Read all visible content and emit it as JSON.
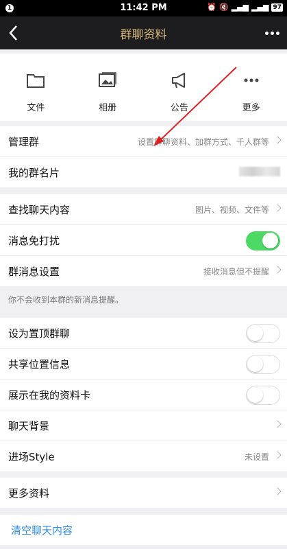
{
  "status": {
    "time": "11:42 PM",
    "notification_badge": "1",
    "battery": "97"
  },
  "nav": {
    "title": "群聊资料"
  },
  "quick_actions": [
    {
      "label": "文件",
      "icon": "folder-icon"
    },
    {
      "label": "相册",
      "icon": "image-icon"
    },
    {
      "label": "公告",
      "icon": "megaphone-icon"
    },
    {
      "label": "更多",
      "icon": "more-dots-icon"
    }
  ],
  "group1": [
    {
      "label": "管理群",
      "value": "设置群聊资料、加群方式、千人群等"
    },
    {
      "label": "我的群名片",
      "value": ""
    }
  ],
  "group2": [
    {
      "label": "查找聊天内容",
      "value": "图片、视频、文件等"
    },
    {
      "label": "消息免打扰",
      "toggle": true
    },
    {
      "label": "群消息设置",
      "value": "接收消息但不提醒"
    }
  ],
  "hint": "你不会收到本群的新消息提醒。",
  "group3": [
    {
      "label": "设为置顶群聊",
      "toggle": false
    },
    {
      "label": "共享位置信息",
      "toggle": false
    },
    {
      "label": "展示在我的资料卡",
      "toggle": false
    },
    {
      "label": "聊天背景",
      "value": ""
    },
    {
      "label": "进场Style",
      "value": "未设置"
    }
  ],
  "group4": [
    {
      "label": "更多资料",
      "value": ""
    }
  ],
  "clear": {
    "label": "清空聊天内容"
  },
  "colors": {
    "nav_bg": "#1d1d1f",
    "title": "#d7b87a",
    "toggle_on": "#4cd964",
    "link": "#2f8ee8",
    "annotation_arrow": "#e02020"
  }
}
